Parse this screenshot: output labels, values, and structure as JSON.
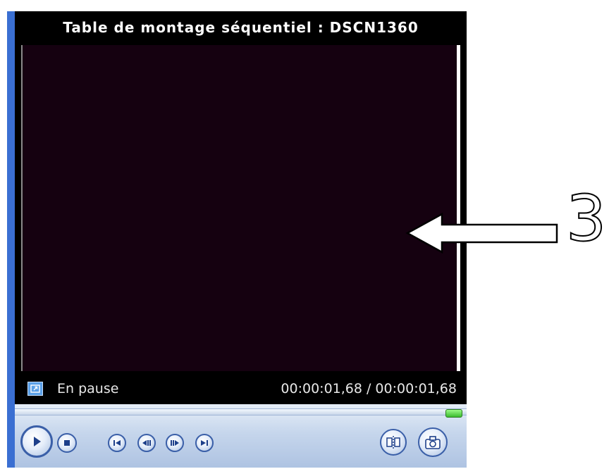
{
  "window": {
    "title": "Table de montage séquentiel : DSCN1360"
  },
  "status": {
    "state": "En pause",
    "time": "00:00:01,68 / 00:00:01,68"
  },
  "controls": {
    "play_icon": "play-icon",
    "stop_icon": "stop-icon",
    "previous_icon": "skip-back-icon",
    "step_back_icon": "frame-back-icon",
    "step_forward_icon": "frame-forward-icon",
    "next_icon": "skip-forward-icon",
    "split_icon": "split-clip-icon",
    "snapshot_icon": "camera-icon"
  },
  "colors": {
    "screen": "#150110",
    "accent": "#3a6fd2",
    "control_bar": "#c6d6ec"
  },
  "annotation": {
    "number": "3"
  }
}
